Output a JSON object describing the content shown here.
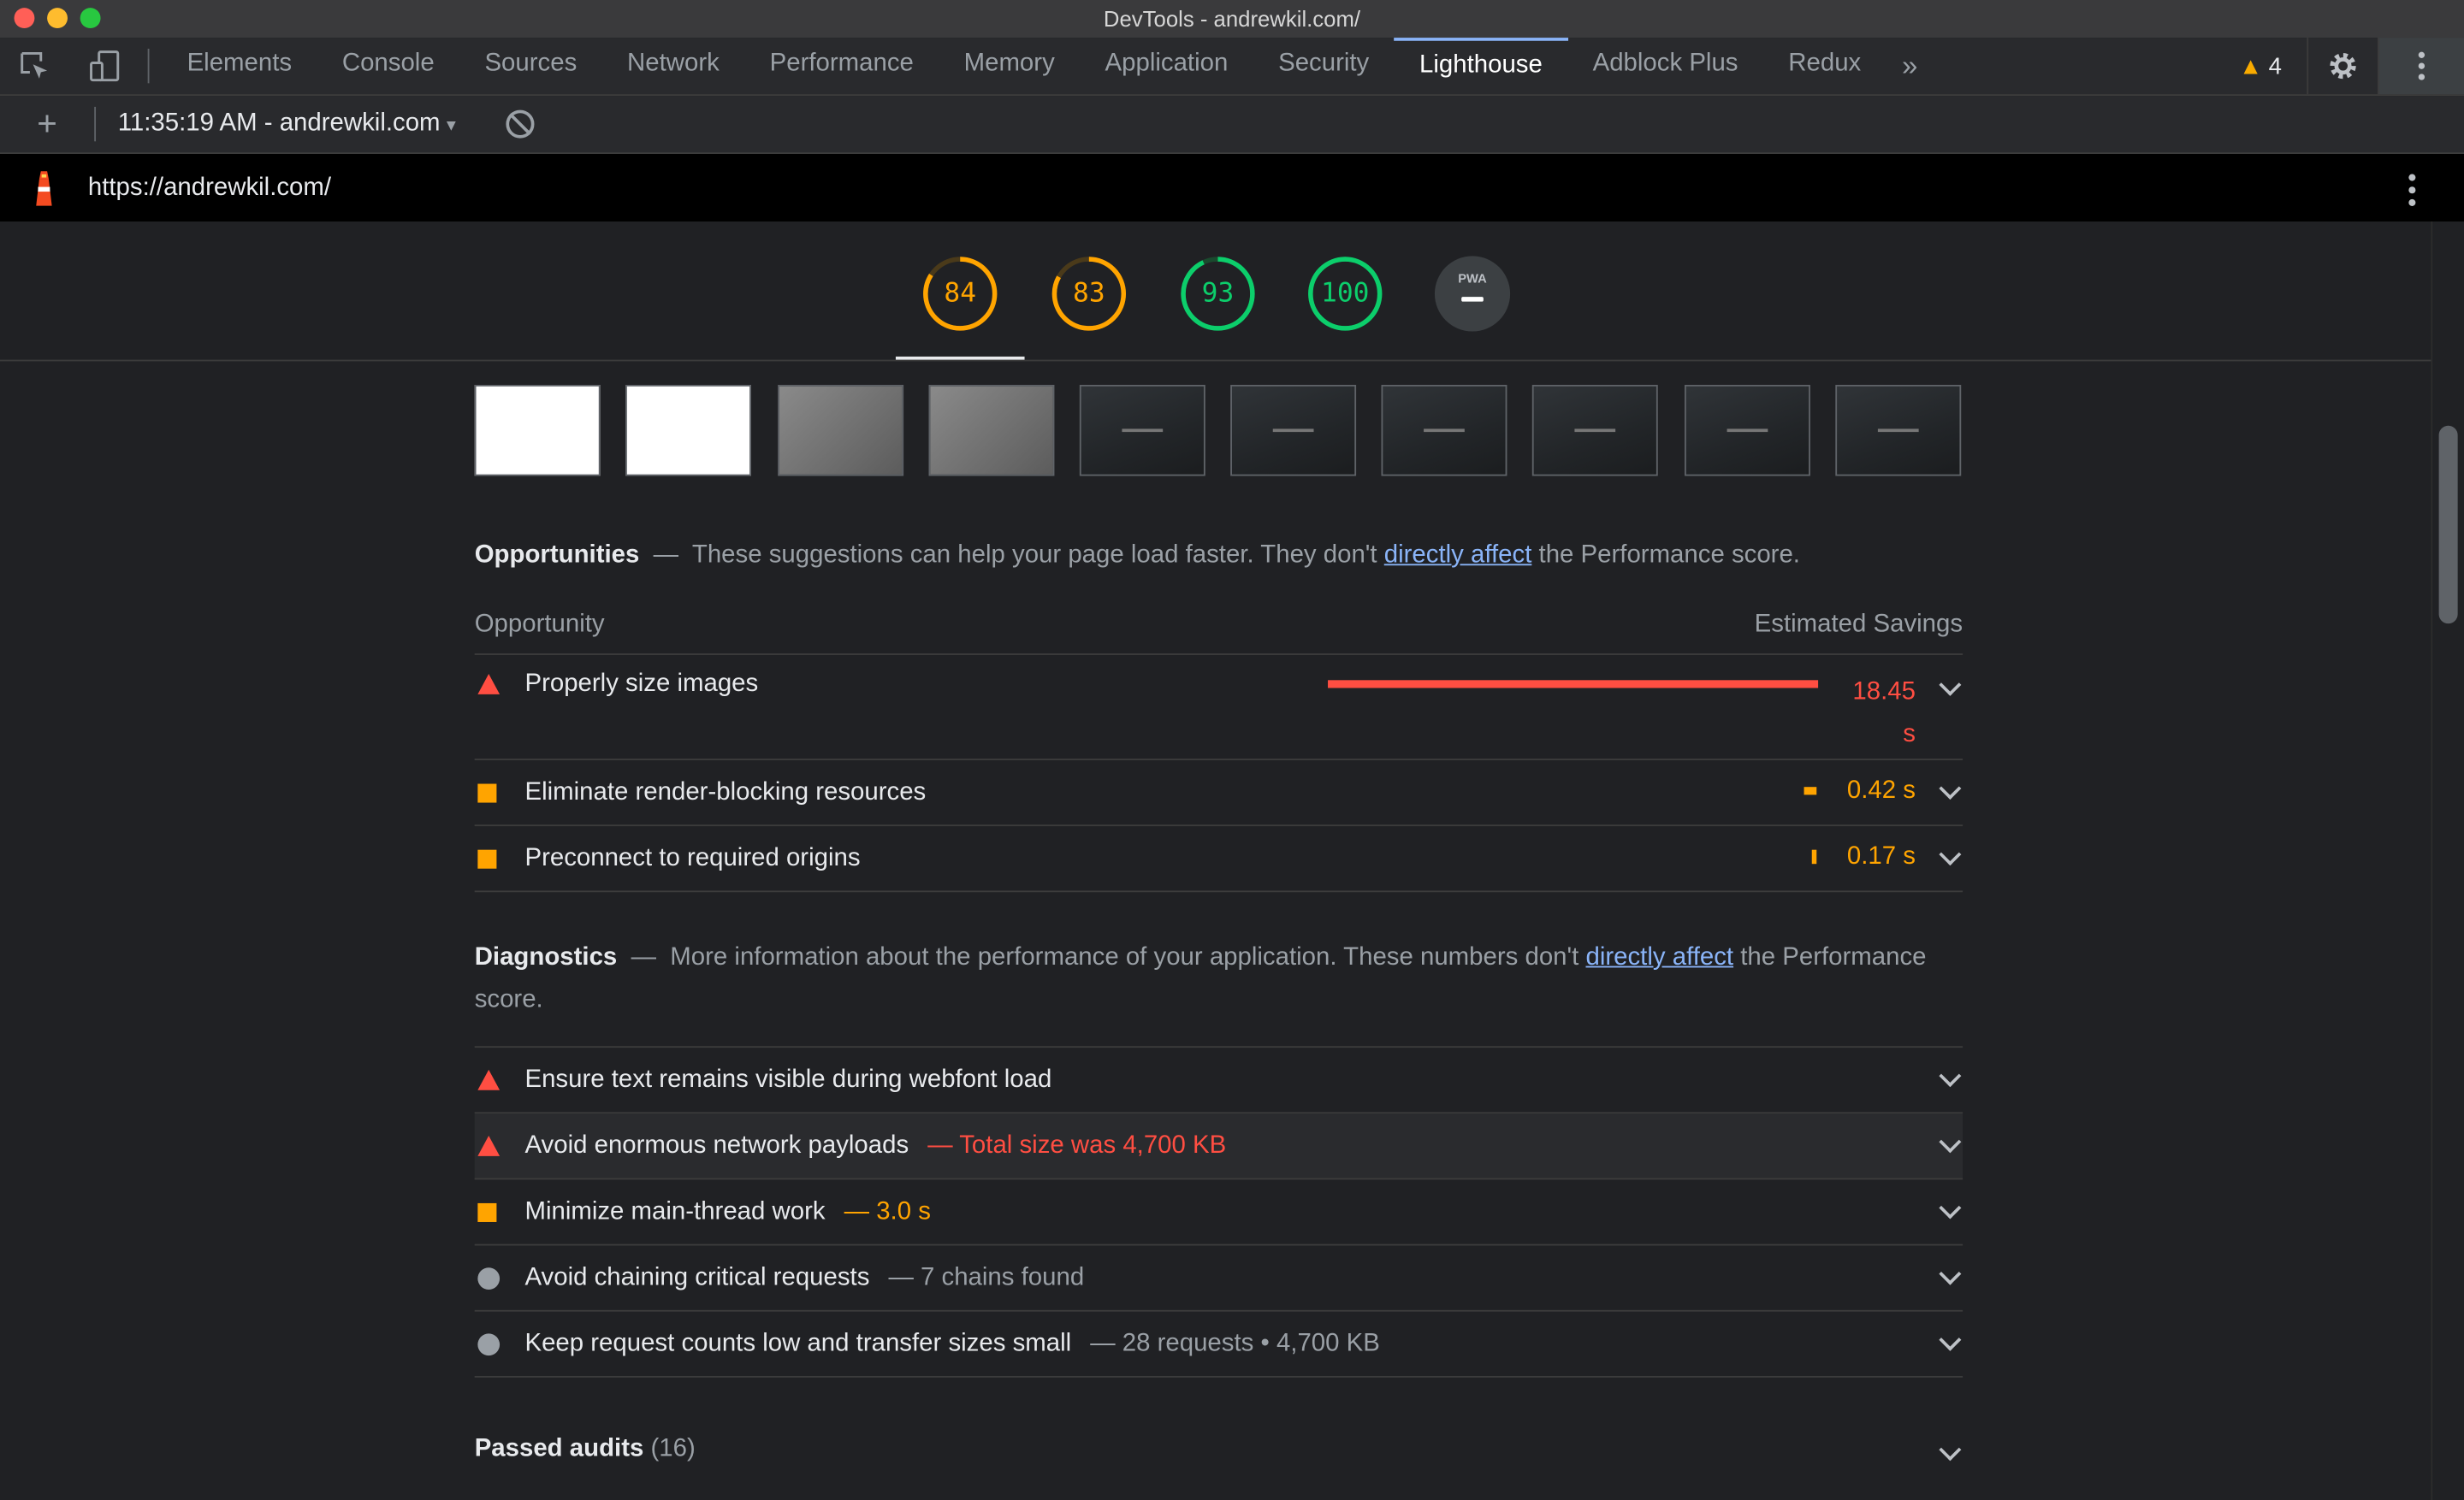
{
  "window": {
    "title": "DevTools - andrewkil.com/"
  },
  "tabs": [
    "Elements",
    "Console",
    "Sources",
    "Network",
    "Performance",
    "Memory",
    "Application",
    "Security",
    "Lighthouse",
    "Adblock Plus",
    "Redux"
  ],
  "active_tab": "Lighthouse",
  "warnings": {
    "count": "4"
  },
  "report": {
    "selector": "11:35:19 AM - andrewkil.com",
    "url": "https://andrewkil.com/"
  },
  "scores": [
    {
      "value": "84",
      "fraction": 0.84,
      "color": "#ffa400"
    },
    {
      "value": "83",
      "fraction": 0.83,
      "color": "#ffa400"
    },
    {
      "value": "93",
      "fraction": 0.93,
      "color": "#0cce6b"
    },
    {
      "value": "100",
      "fraction": 1.0,
      "color": "#0cce6b"
    }
  ],
  "pwa": {
    "label": "PWA"
  },
  "opportunities": {
    "title": "Opportunities",
    "dash": "—",
    "desc_before": "These suggestions can help your page load faster. They don't",
    "link": "directly affect",
    "desc_after": "the Performance score.",
    "col_left": "Opportunity",
    "col_right": "Estimated Savings",
    "items": [
      {
        "label": "Properly size images",
        "savings": "18.45",
        "unit": "s",
        "fraction": 1.0,
        "severity": "fail"
      },
      {
        "label": "Eliminate render-blocking resources",
        "savings": "0.42 s",
        "fraction": 0.023,
        "severity": "average"
      },
      {
        "label": "Preconnect to required origins",
        "savings": "0.17 s",
        "fraction": 0.009,
        "severity": "average"
      }
    ]
  },
  "diagnostics": {
    "title": "Diagnostics",
    "dash": "—",
    "desc_before": "More information about the performance of your application. These numbers don't",
    "link": "directly affect",
    "desc_after": "the Performance score.",
    "items": [
      {
        "label": "Ensure text remains visible during webfont load",
        "detail": "",
        "severity": "fail"
      },
      {
        "label": "Avoid enormous network payloads",
        "detail": "— Total size was 4,700 KB",
        "severity": "fail"
      },
      {
        "label": "Minimize main-thread work",
        "detail": "— 3.0 s",
        "severity": "average"
      },
      {
        "label": "Avoid chaining critical requests",
        "detail": "— 7 chains found",
        "severity": "info"
      },
      {
        "label": "Keep request counts low and transfer sizes small",
        "detail": "— 28 requests • 4,700 KB",
        "severity": "info"
      }
    ]
  },
  "passed": {
    "label": "Passed audits",
    "count": "(16)"
  },
  "colors": {
    "fail": "#ff4e42",
    "average": "#ffa400",
    "pass": "#0cce6b",
    "link": "#8ab4f8"
  }
}
